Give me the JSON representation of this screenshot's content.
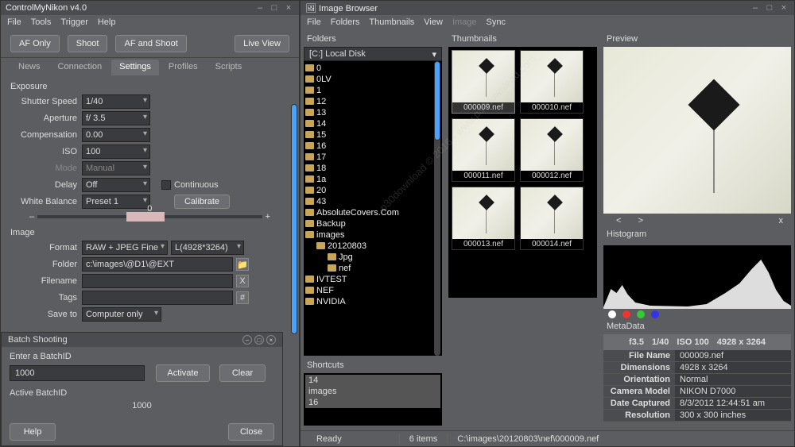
{
  "left": {
    "title": "ControlMyNikon v4.0",
    "menu": [
      "File",
      "Tools",
      "Trigger",
      "Help"
    ],
    "toolbar": {
      "af_only": "AF Only",
      "shoot": "Shoot",
      "af_shoot": "AF and Shoot",
      "live_view": "Live View"
    },
    "tabs": [
      "News",
      "Connection",
      "Settings",
      "Profiles",
      "Scripts"
    ],
    "active_tab": "Settings",
    "exposure": {
      "title": "Exposure",
      "shutter_label": "Shutter Speed",
      "shutter": "1/40",
      "aperture_label": "Aperture",
      "aperture": "f/ 3.5",
      "comp_label": "Compensation",
      "comp": "0.00",
      "iso_label": "ISO",
      "iso": "100",
      "mode_label": "Mode",
      "mode": "Manual",
      "delay_label": "Delay",
      "delay": "Off",
      "continuous_label": "Continuous",
      "wb_label": "White Balance",
      "wb": "Preset 1",
      "calibrate": "Calibrate",
      "slider_val": "0"
    },
    "image": {
      "title": "Image",
      "format_label": "Format",
      "format": "RAW + JPEG Fine",
      "size": "L(4928*3264)",
      "folder_label": "Folder",
      "folder": "c:\\images\\@D1\\@EXT",
      "filename_label": "Filename",
      "filename": "",
      "tags_label": "Tags",
      "tags": "",
      "saveto_label": "Save to",
      "saveto": "Computer only"
    }
  },
  "batch": {
    "title": "Batch Shooting",
    "enter_label": "Enter a BatchID",
    "value": "1000",
    "activate": "Activate",
    "clear": "Clear",
    "active_label": "Active BatchID",
    "active_value": "1000",
    "help": "Help",
    "close": "Close"
  },
  "right": {
    "title": "Image Browser",
    "menu": [
      "File",
      "Folders",
      "Thumbnails",
      "View",
      "Image",
      "Sync"
    ],
    "folders": {
      "label": "Folders",
      "drive": "[C:] Local Disk",
      "items": [
        {
          "n": "0",
          "d": 0
        },
        {
          "n": "0LV",
          "d": 0
        },
        {
          "n": "1",
          "d": 0
        },
        {
          "n": "12",
          "d": 0
        },
        {
          "n": "13",
          "d": 0
        },
        {
          "n": "14",
          "d": 0
        },
        {
          "n": "15",
          "d": 0
        },
        {
          "n": "16",
          "d": 0
        },
        {
          "n": "17",
          "d": 0
        },
        {
          "n": "18",
          "d": 0
        },
        {
          "n": "1a",
          "d": 0
        },
        {
          "n": "20",
          "d": 0
        },
        {
          "n": "43",
          "d": 0
        },
        {
          "n": "AbsoluteCovers.Com",
          "d": 0
        },
        {
          "n": "Backup",
          "d": 0
        },
        {
          "n": "images",
          "d": 0
        },
        {
          "n": "20120803",
          "d": 1
        },
        {
          "n": "Jpg",
          "d": 2
        },
        {
          "n": "nef",
          "d": 2
        },
        {
          "n": "IVTEST",
          "d": 0
        },
        {
          "n": "NEF",
          "d": 0
        },
        {
          "n": "NVIDIA",
          "d": 0
        }
      ]
    },
    "shortcuts": {
      "label": "Shortcuts",
      "items": [
        "14",
        "images",
        "16"
      ]
    },
    "thumbs": {
      "label": "Thumbnails",
      "items": [
        "000009.nef",
        "000010.nef",
        "000011.nef",
        "000012.nef",
        "000013.nef",
        "000014.nef"
      ],
      "selected": 0
    },
    "preview": {
      "label": "Preview",
      "prev": "<",
      "next": ">",
      "close": "x"
    },
    "histogram": {
      "label": "Histogram",
      "dots": [
        "#fff",
        "#e33",
        "#3c3",
        "#33e"
      ]
    },
    "metadata": {
      "label": "MetaData",
      "summary": [
        "f3.5",
        "1/40",
        "ISO 100",
        "4928 x 3264"
      ],
      "rows": [
        {
          "k": "File Name",
          "v": "000009.nef"
        },
        {
          "k": "Dimensions",
          "v": "4928 x 3264"
        },
        {
          "k": "Orientation",
          "v": "Normal"
        },
        {
          "k": "Camera Model",
          "v": "NIKON D7000"
        },
        {
          "k": "Date Captured",
          "v": "8/3/2012 12:44:51 am"
        },
        {
          "k": "Resolution",
          "v": "300 x 300 inches"
        }
      ]
    },
    "status": {
      "ready": "Ready",
      "count": "6 items",
      "path": "C:\\images\\20120803\\nef\\000009.nef"
    }
  },
  "watermark": "p30download © 2016 - www.p30download.com"
}
